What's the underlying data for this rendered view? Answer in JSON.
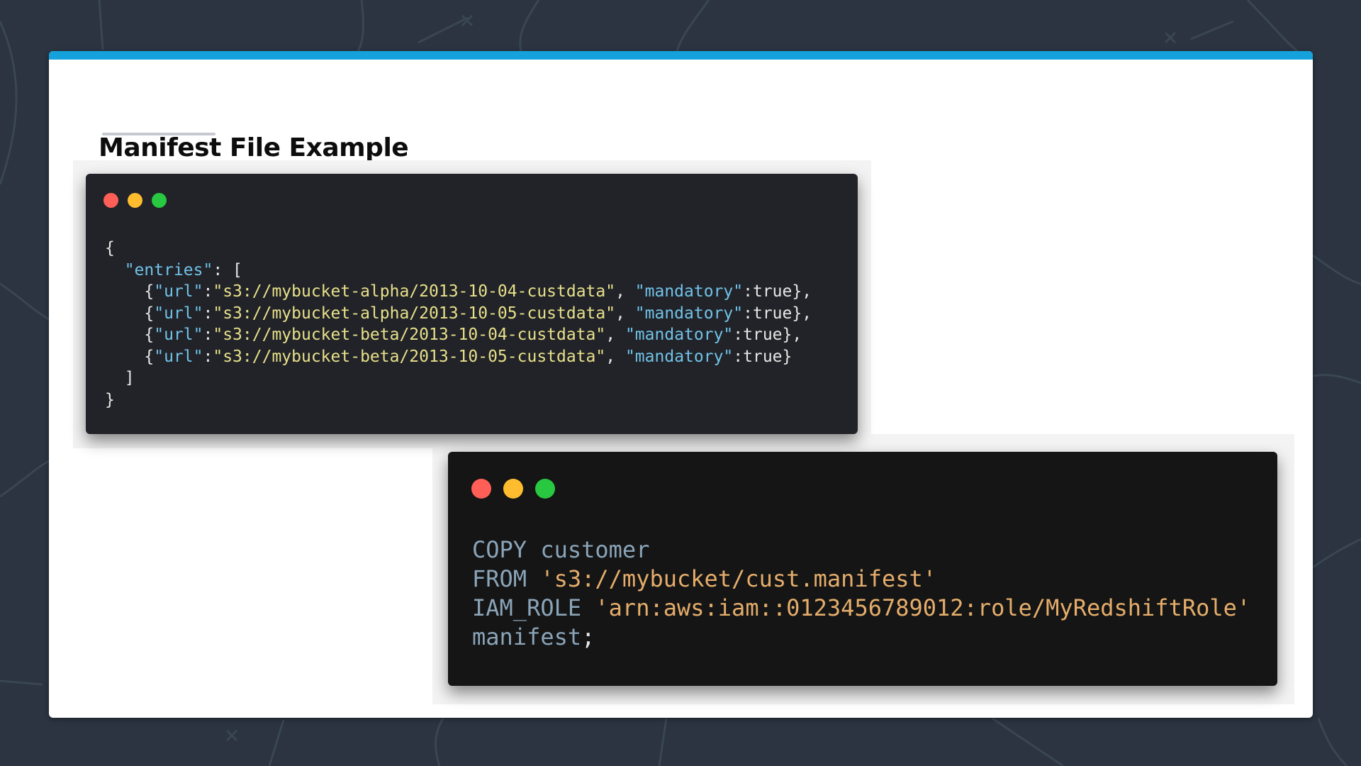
{
  "slide": {
    "title": "Manifest File Example",
    "accent_color": "#15a2dc"
  },
  "json_window": {
    "window_controls": [
      "close",
      "minimize",
      "maximize"
    ],
    "lines": [
      [
        {
          "t": "{",
          "c": "pun"
        }
      ],
      [
        {
          "t": "  ",
          "c": "pun"
        },
        {
          "t": "\"entries\"",
          "c": "key"
        },
        {
          "t": ": [",
          "c": "pun"
        }
      ],
      [
        {
          "t": "    {",
          "c": "pun"
        },
        {
          "t": "\"url\"",
          "c": "key"
        },
        {
          "t": ":",
          "c": "pun"
        },
        {
          "t": "\"s3://mybucket-alpha/2013-10-04-custdata\"",
          "c": "str"
        },
        {
          "t": ", ",
          "c": "pun"
        },
        {
          "t": "\"mandatory\"",
          "c": "key"
        },
        {
          "t": ":true},",
          "c": "pun"
        }
      ],
      [
        {
          "t": "    {",
          "c": "pun"
        },
        {
          "t": "\"url\"",
          "c": "key"
        },
        {
          "t": ":",
          "c": "pun"
        },
        {
          "t": "\"s3://mybucket-alpha/2013-10-05-custdata\"",
          "c": "str"
        },
        {
          "t": ", ",
          "c": "pun"
        },
        {
          "t": "\"mandatory\"",
          "c": "key"
        },
        {
          "t": ":true},",
          "c": "pun"
        }
      ],
      [
        {
          "t": "    {",
          "c": "pun"
        },
        {
          "t": "\"url\"",
          "c": "key"
        },
        {
          "t": ":",
          "c": "pun"
        },
        {
          "t": "\"s3://mybucket-beta/2013-10-04-custdata\"",
          "c": "str"
        },
        {
          "t": ", ",
          "c": "pun"
        },
        {
          "t": "\"mandatory\"",
          "c": "key"
        },
        {
          "t": ":true},",
          "c": "pun"
        }
      ],
      [
        {
          "t": "    {",
          "c": "pun"
        },
        {
          "t": "\"url\"",
          "c": "key"
        },
        {
          "t": ":",
          "c": "pun"
        },
        {
          "t": "\"s3://mybucket-beta/2013-10-05-custdata\"",
          "c": "str"
        },
        {
          "t": ", ",
          "c": "pun"
        },
        {
          "t": "\"mandatory\"",
          "c": "key"
        },
        {
          "t": ":true}",
          "c": "pun"
        }
      ],
      [
        {
          "t": "  ]",
          "c": "pun"
        }
      ],
      [
        {
          "t": "}",
          "c": "pun"
        }
      ]
    ]
  },
  "sql_window": {
    "window_controls": [
      "close",
      "minimize",
      "maximize"
    ],
    "lines": [
      [
        {
          "t": "COPY customer",
          "c": "kw"
        }
      ],
      [
        {
          "t": "FROM ",
          "c": "kw"
        },
        {
          "t": "'s3://mybucket/cust.manifest'",
          "c": "sqlstr"
        }
      ],
      [
        {
          "t": "IAM_ROLE ",
          "c": "kw"
        },
        {
          "t": "'arn:aws:iam::0123456789012:role/MyRedshiftRole'",
          "c": "sqlstr"
        }
      ],
      [
        {
          "t": "manifest",
          "c": "kw"
        },
        {
          "t": ";",
          "c": "pun"
        }
      ]
    ]
  },
  "colors": {
    "background": "#2b3440",
    "json_panel": "#212328",
    "sql_panel": "#151515",
    "json_key": "#71c2e8",
    "json_string": "#e8e08a",
    "sql_keyword": "#8aa4b8",
    "sql_string": "#e5ad6b",
    "dot_red": "#ff5f57",
    "dot_yellow": "#febc2e",
    "dot_green": "#28c840"
  }
}
